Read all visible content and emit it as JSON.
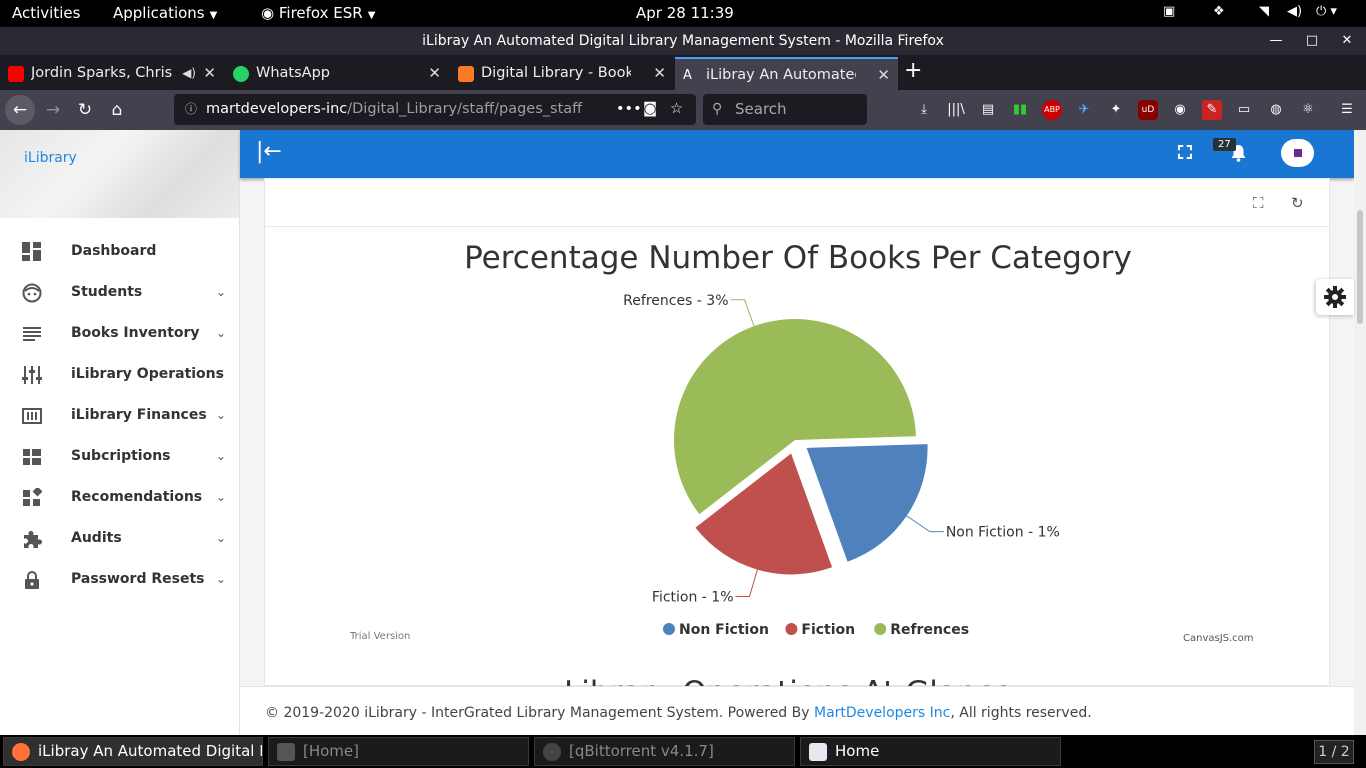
{
  "gnome": {
    "activities": "Activities",
    "applications": "Applications",
    "app_name": "Firefox ESR",
    "clock": "Apr 28  11:39"
  },
  "window": {
    "title": "iLibray An Automated Digital Library Management System - Mozilla Firefox"
  },
  "tabs": [
    {
      "label": "Jordin Sparks, Chris",
      "favicon_color": "#ff0000"
    },
    {
      "label": "WhatsApp",
      "favicon_color": "#25d366"
    },
    {
      "label": "Digital Library - Book Gu",
      "favicon_color": "#fb7a24"
    },
    {
      "label": "iLibray An Automated D",
      "favicon_color": "#ffffff"
    }
  ],
  "navbar": {
    "url_host": "martdevelopers-inc",
    "url_path": "/Digital_Library/staff/pages_staff",
    "search_placeholder": "Search"
  },
  "app": {
    "brand": "iLibrary",
    "notif_count": "27",
    "menu": [
      {
        "label": "Dashboard",
        "icon": "dashboard-icon",
        "has_caret": false
      },
      {
        "label": "Students",
        "icon": "face-icon",
        "has_caret": true
      },
      {
        "label": "Books Inventory",
        "icon": "list-icon",
        "has_caret": true
      },
      {
        "label": "iLibrary Operations",
        "icon": "sliders-icon",
        "has_caret": true
      },
      {
        "label": "iLibrary Finances",
        "icon": "finance-icon",
        "has_caret": true
      },
      {
        "label": "Subcriptions",
        "icon": "grid-icon",
        "has_caret": true
      },
      {
        "label": "Recomendations",
        "icon": "widgets-icon",
        "has_caret": true
      },
      {
        "label": "Audits",
        "icon": "puzzle-icon",
        "has_caret": true
      },
      {
        "label": "Password Resets",
        "icon": "lock-icon",
        "has_caret": true
      }
    ],
    "next_section_title": "Library Operations At Glance",
    "footer": {
      "text_before": "© 2019-2020 iLibrary - InterGrated Library Management System. Powered By ",
      "link": "MartDevelopers Inc",
      "text_after": ", All rights reserved."
    }
  },
  "chart_data": {
    "type": "pie",
    "title": "Percentage Number Of Books Per Category",
    "categories": [
      "Non Fiction",
      "Fiction",
      "Refrences"
    ],
    "values": [
      1,
      1,
      3
    ],
    "index_labels": [
      "Non Fiction - 1%",
      "Fiction - 1%",
      "Refrences - 3%"
    ],
    "colors": [
      "#4f81bc",
      "#c0504e",
      "#9bbb58"
    ],
    "exploded": [
      "Non Fiction",
      "Fiction"
    ],
    "legend_position": "bottom",
    "watermark_left": "Trial Version",
    "watermark_right": "CanvasJS.com"
  },
  "taskbar": [
    {
      "label": "iLibray An Automated Digital L...",
      "active": true
    },
    {
      "label": "[Home]",
      "active": false
    },
    {
      "label": "[qBittorrent v4.1.7]",
      "active": false
    },
    {
      "label": "Home",
      "active": false
    }
  ],
  "workspace": "1 / 2"
}
